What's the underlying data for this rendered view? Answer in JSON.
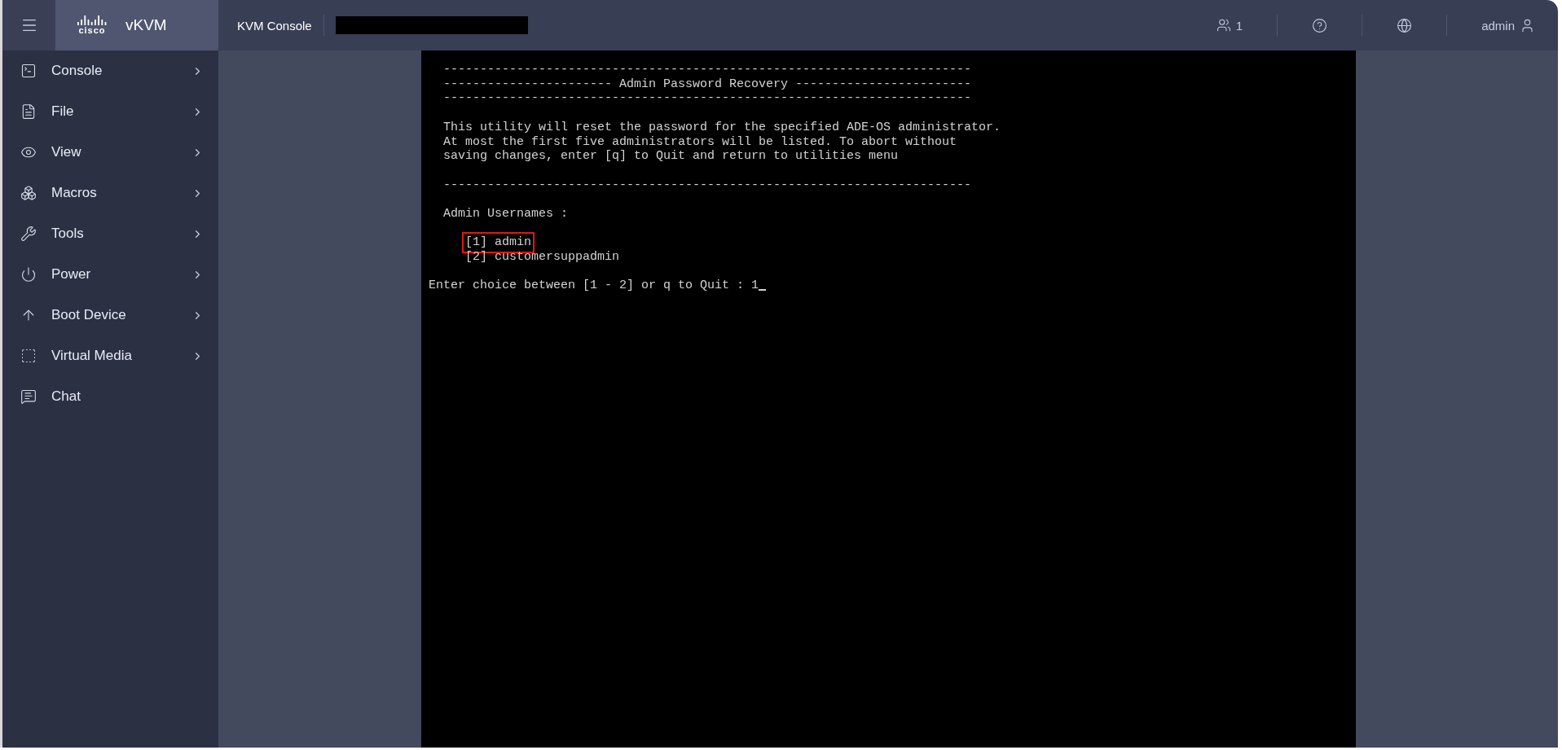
{
  "header": {
    "logo_text": "cisco",
    "app_name": "vKVM",
    "title": "KVM Console",
    "users_count": "1",
    "user_name": "admin"
  },
  "sidebar": {
    "items": [
      {
        "label": "Console",
        "has_submenu": true
      },
      {
        "label": "File",
        "has_submenu": true
      },
      {
        "label": "View",
        "has_submenu": true
      },
      {
        "label": "Macros",
        "has_submenu": true
      },
      {
        "label": "Tools",
        "has_submenu": true
      },
      {
        "label": "Power",
        "has_submenu": true
      },
      {
        "label": "Boot Device",
        "has_submenu": true
      },
      {
        "label": "Virtual Media",
        "has_submenu": true
      },
      {
        "label": "Chat",
        "has_submenu": false
      }
    ]
  },
  "terminal": {
    "blocks": [
      {
        "kind": "rules",
        "lines": [
          "------------------------------------------------------------------------",
          "----------------------- Admin Password Recovery ------------------------",
          "------------------------------------------------------------------------"
        ]
      },
      {
        "kind": "text",
        "lines": [
          "This utility will reset the password for the specified ADE-OS administrator.",
          "At most the first five administrators will be listed. To abort without",
          "saving changes, enter [q] to Quit and return to utilities menu"
        ]
      },
      {
        "kind": "rules",
        "lines": [
          "------------------------------------------------------------------------"
        ]
      },
      {
        "kind": "text",
        "lines": [
          "Admin Usernames :"
        ]
      },
      {
        "kind": "options",
        "options": [
          {
            "label": "[1] admin",
            "selected": true
          },
          {
            "label": "[2] customersuppadmin",
            "selected": false
          }
        ]
      },
      {
        "kind": "prompt",
        "text": "Enter choice between [1 - 2] or q to Quit :",
        "value": "1"
      }
    ]
  }
}
